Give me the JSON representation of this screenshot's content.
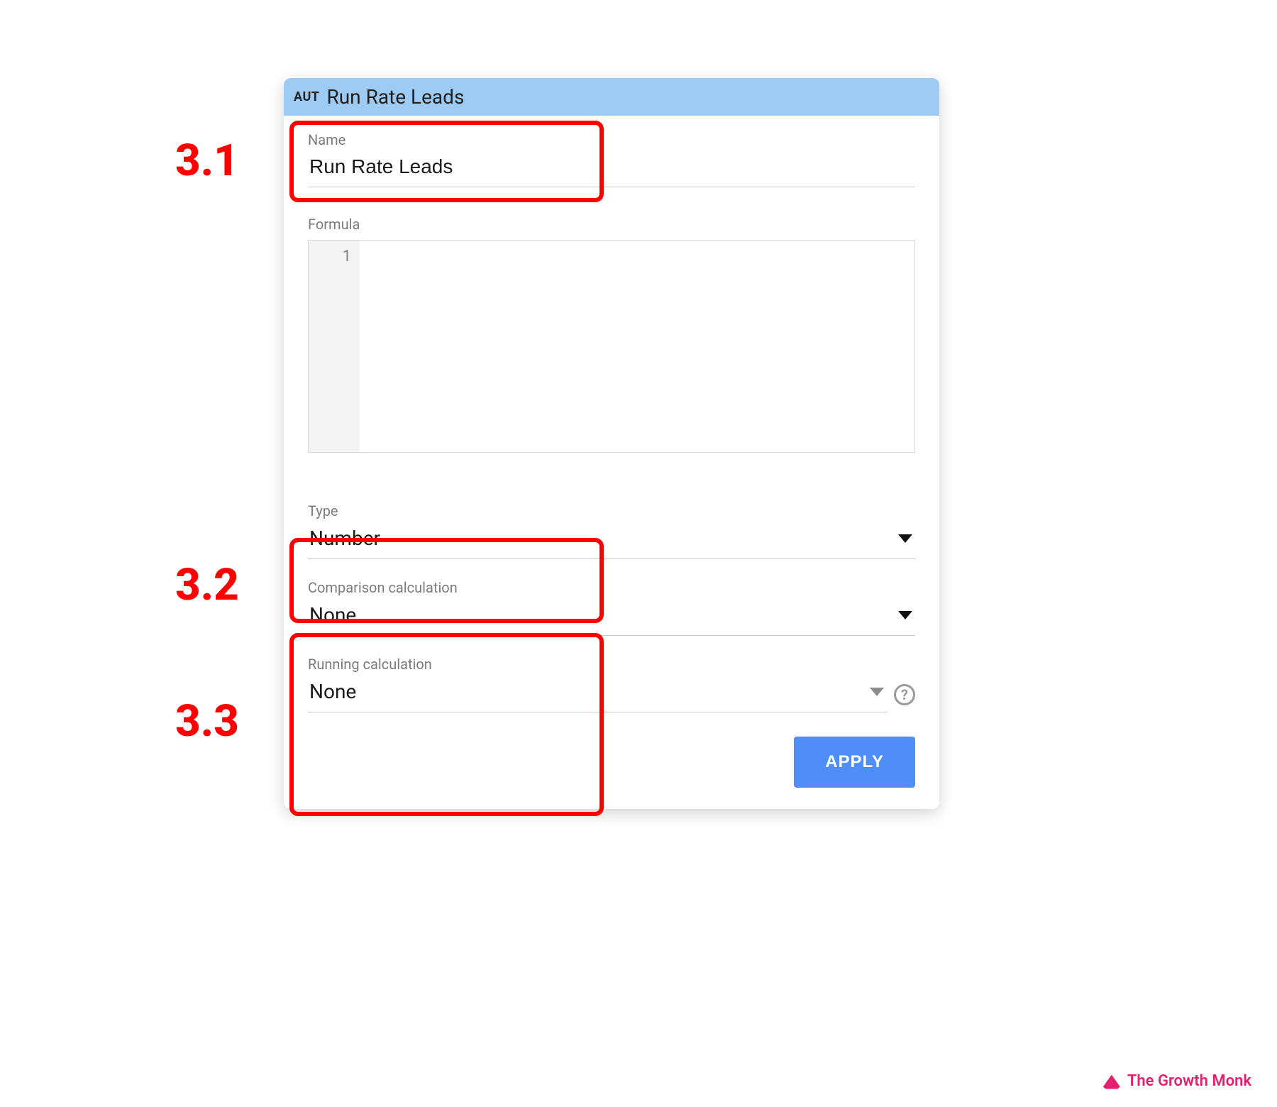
{
  "dialog": {
    "badge": "AUT",
    "title": "Run Rate Leads",
    "name_label": "Name",
    "name_value": "Run Rate Leads",
    "formula_label": "Formula",
    "formula_gutter": "1",
    "formula_value": "",
    "type_label": "Type",
    "type_value": "Number",
    "comparison_label": "Comparison calculation",
    "comparison_value": "None",
    "running_label": "Running calculation",
    "running_value": "None",
    "apply_label": "APPLY"
  },
  "annotations": {
    "step_name": "3.1",
    "step_type": "3.2",
    "step_calc": "3.3"
  },
  "brand": {
    "name": "The Growth Monk"
  },
  "colors": {
    "header_bg": "#9ecbf4",
    "apply_bg": "#4f8ef6",
    "annotation": "#ff0000",
    "brand": "#e61e6e"
  }
}
